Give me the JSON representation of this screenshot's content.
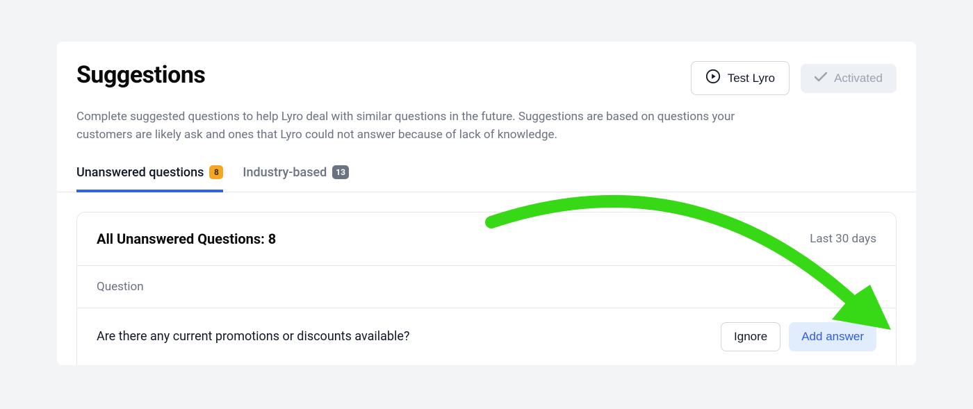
{
  "header": {
    "title": "Suggestions",
    "test_button_label": "Test Lyro",
    "activated_label": "Activated"
  },
  "description": "Complete suggested questions to help Lyro deal with similar questions in the future. Suggestions are based on questions your customers are likely ask and ones that Lyro could not answer because of lack of knowledge.",
  "tabs": {
    "unanswered": {
      "label": "Unanswered questions",
      "count": "8"
    },
    "industry": {
      "label": "Industry-based",
      "count": "13"
    }
  },
  "panel": {
    "title": "All Unanswered Questions: 8",
    "range_label": "Last 30 days",
    "column_label": "Question"
  },
  "questions": [
    {
      "text": "Are there any current promotions or discounts available?",
      "ignore_label": "Ignore",
      "add_label": "Add answer"
    }
  ]
}
